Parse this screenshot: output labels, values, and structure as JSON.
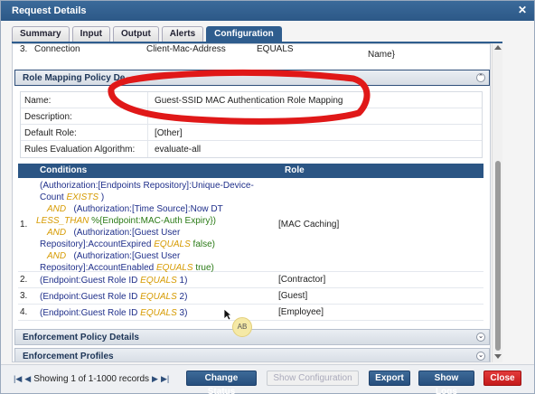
{
  "title": "Request Details",
  "tabs": [
    {
      "label": "Summary"
    },
    {
      "label": "Input"
    },
    {
      "label": "Output"
    },
    {
      "label": "Alerts"
    },
    {
      "label": "Configuration"
    }
  ],
  "partial_row": {
    "num": "3.",
    "name": "Connection",
    "attr": "Client-Mac-Address",
    "op": "EQUALS",
    "value": "Name}"
  },
  "role_mapping_header": "Role Mapping Policy De",
  "policy": {
    "name_label": "Name:",
    "name_value": "Guest-SSID MAC Authentication Role Mapping",
    "description_label": "Description:",
    "description_value": "",
    "default_role_label": "Default Role:",
    "default_role_value": "[Other]",
    "algorithm_label": "Rules Evaluation Algorithm:",
    "algorithm_value": "evaluate-all"
  },
  "rules_table": {
    "conditions_header": "Conditions",
    "role_header": "Role",
    "rows": [
      {
        "num": "1.",
        "lines": [
          {
            "a": "(Authorization:[Endpoints Repository]:Unique-Device-",
            "b": ""
          },
          {
            "a": "Count",
            "k": "EXISTS",
            "b": ")"
          },
          {
            "and": "AND",
            "a": "(Authorization:[Time Source]:Now DT"
          },
          {
            "k": "LESS_THAN",
            "g": "%{Endpoint:MAC-Auth Expiry})"
          },
          {
            "and": "AND",
            "a": "(Authorization:[Guest User"
          },
          {
            "a": "Repository]:AccountExpired",
            "k": "EQUALS",
            "g": "false)"
          },
          {
            "and": "AND",
            "a": "(Authorization:[Guest User"
          },
          {
            "a": "Repository]:AccountEnabled",
            "k": "EQUALS",
            "g": "true)"
          }
        ],
        "role": "[MAC Caching]"
      },
      {
        "num": "2.",
        "cond": "(Endpoint:Guest Role ID",
        "op": "EQUALS",
        "val": "1)",
        "role": "[Contractor]"
      },
      {
        "num": "3.",
        "cond": "(Endpoint:Guest Role ID",
        "op": "EQUALS",
        "val": "2)",
        "role": "[Guest]"
      },
      {
        "num": "4.",
        "cond": "(Endpoint:Guest Role ID",
        "op": "EQUALS",
        "val": "3)",
        "role": "[Employee]"
      }
    ]
  },
  "sections": {
    "enforcement_policy": "Enforcement Policy Details",
    "enforcement_profiles": "Enforcement Profiles"
  },
  "badge": "AB",
  "footer": {
    "showing": "Showing 1 of 1-1000 records",
    "change_status": "Change Status",
    "show_configuration": "Show Configuration",
    "export": "Export",
    "show_logs": "Show Logs",
    "close": "Close"
  },
  "colors": {
    "accent": "#2f5d8e",
    "close": "#d32626",
    "annotation": "#e01818"
  }
}
